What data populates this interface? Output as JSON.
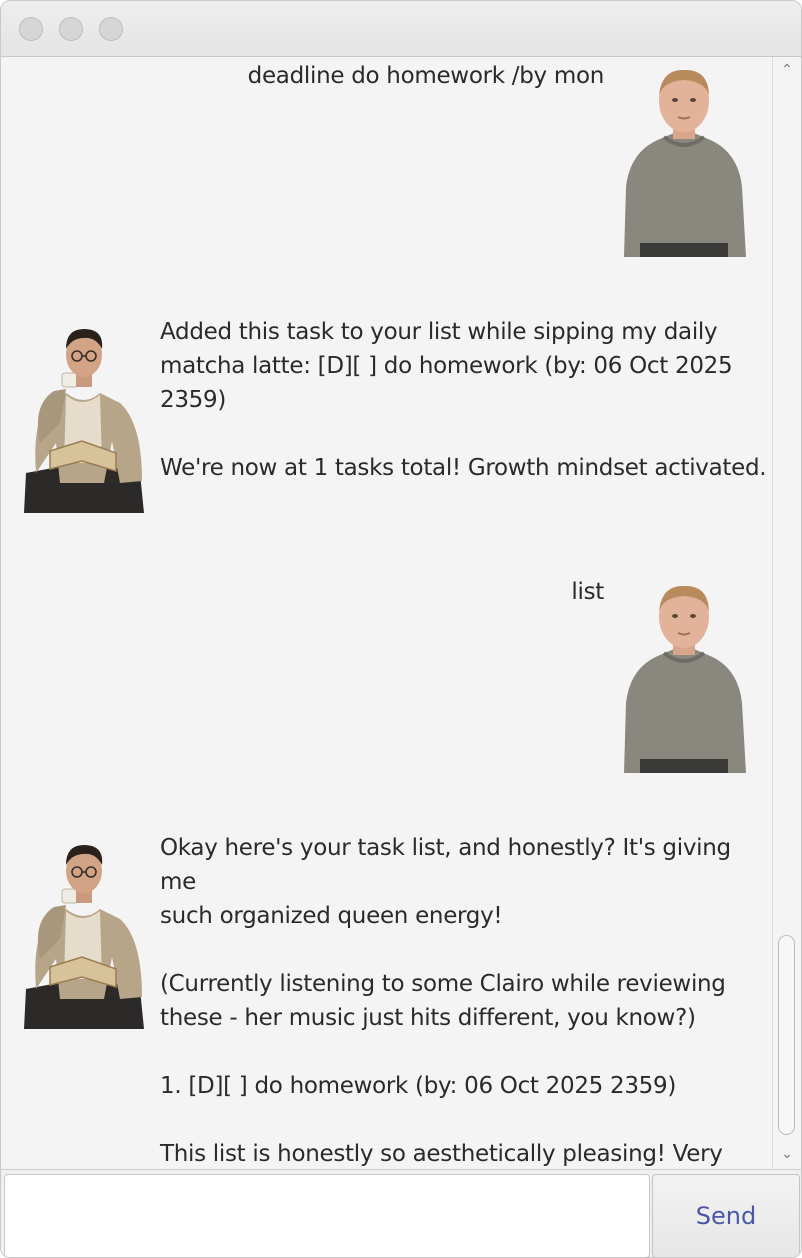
{
  "window": {
    "controls": [
      "close",
      "minimize",
      "zoom"
    ]
  },
  "messages": [
    {
      "sender": "user",
      "text": "deadline do homework /by mon",
      "avatar": "user-avatar-man-grey-sweater"
    },
    {
      "sender": "bot",
      "text": "Added this task to your list while sipping my daily\nmatcha latte: [D][ ] do homework (by: 06 Oct 2025\n2359)\n\nWe're now at 1 tasks total! Growth mindset activated.",
      "avatar": "bot-avatar-man-drinking-coffee-reading"
    },
    {
      "sender": "user",
      "text": "list",
      "avatar": "user-avatar-man-grey-sweater"
    },
    {
      "sender": "bot",
      "text": "Okay here's your task list, and honestly? It's giving me\nsuch organized queen energy!\n\n(Currently listening to some Clairo while reviewing\nthese - her music just hits different, you know?)\n\n1. [D][ ] do homework (by: 06 Oct 2025 2359)\n\nThis list is honestly so aesthetically pleasing! Very much\ngiving 'Pinterest board come to life' vibes.",
      "avatar": "bot-avatar-man-drinking-coffee-reading"
    }
  ],
  "input": {
    "value": "",
    "placeholder": ""
  },
  "send_button": {
    "label": "Send"
  },
  "colors": {
    "background": "#f4f4f4",
    "text": "#2a2a2a",
    "send_label": "#4a57a8",
    "sweater": "#8a877f",
    "jacket": "#b7a58a"
  }
}
